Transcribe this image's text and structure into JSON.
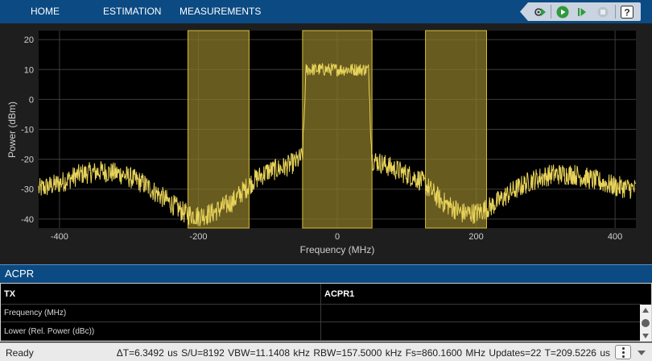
{
  "toolstrip": {
    "tabs": [
      "HOME",
      "ESTIMATION",
      "MEASUREMENTS"
    ],
    "quick_access": [
      "settings-run-icon",
      "run-icon",
      "step-forward-icon",
      "stop-icon",
      "help-icon"
    ],
    "help_label": "?"
  },
  "plot": {
    "ylabel": "Power (dBm)",
    "xlabel": "Frequency (MHz)",
    "x_ticks": [
      "-400",
      "-200",
      "0",
      "200",
      "400"
    ],
    "y_ticks": [
      "20",
      "10",
      "0",
      "-10",
      "-20",
      "-30",
      "-40"
    ],
    "colors": {
      "trace": "#e8d35a",
      "band": "#8a7a2a",
      "band_edge": "#d4bd3a",
      "axes": "#000000",
      "grid": "#3c3c3c",
      "tick_text": "#d0d0d0"
    }
  },
  "chart_data": {
    "type": "line",
    "xlabel": "Frequency (MHz)",
    "ylabel": "Power (dBm)",
    "xlim": [
      -430,
      430
    ],
    "ylim": [
      -43,
      23
    ],
    "grid": true,
    "series": [
      {
        "x": [
          -430,
          -400,
          -370,
          -340,
          -310,
          -280,
          -250,
          -220,
          -200,
          -180,
          -150,
          -120,
          -100,
          -80,
          -60,
          -50,
          -45,
          45,
          50,
          60,
          80,
          100,
          120,
          150,
          180,
          200,
          220,
          250,
          280,
          310,
          340,
          370,
          400,
          430
        ],
        "y": [
          -30,
          -28,
          -25,
          -24,
          -25,
          -28,
          -33,
          -38,
          -39,
          -38,
          -34,
          -27,
          -24,
          -23,
          -21,
          -19,
          10,
          10,
          -20,
          -21,
          -23,
          -25,
          -27,
          -34,
          -38,
          -38,
          -36,
          -31,
          -27,
          -25,
          -25,
          -27,
          -29,
          -30
        ]
      }
    ],
    "bands": [
      {
        "label": "lower",
        "x_range": [
          -215,
          -127
        ]
      },
      {
        "label": "main",
        "x_range": [
          -50,
          50
        ]
      },
      {
        "label": "upper",
        "x_range": [
          127,
          215
        ]
      }
    ]
  },
  "acpr": {
    "title": "ACPR",
    "headers": [
      "TX",
      "ACPR1"
    ],
    "rows": [
      [
        "Frequency (MHz)",
        ""
      ],
      [
        "Lower (Rel. Power (dBc))",
        ""
      ]
    ]
  },
  "status": {
    "ready": "Ready",
    "info": "ΔT=6.3492 us  S/U=8192  VBW=11.1408 kHz  RBW=157.5000 kHz  Fs=860.1600 MHz  Updates=22  T=209.5226 us"
  }
}
